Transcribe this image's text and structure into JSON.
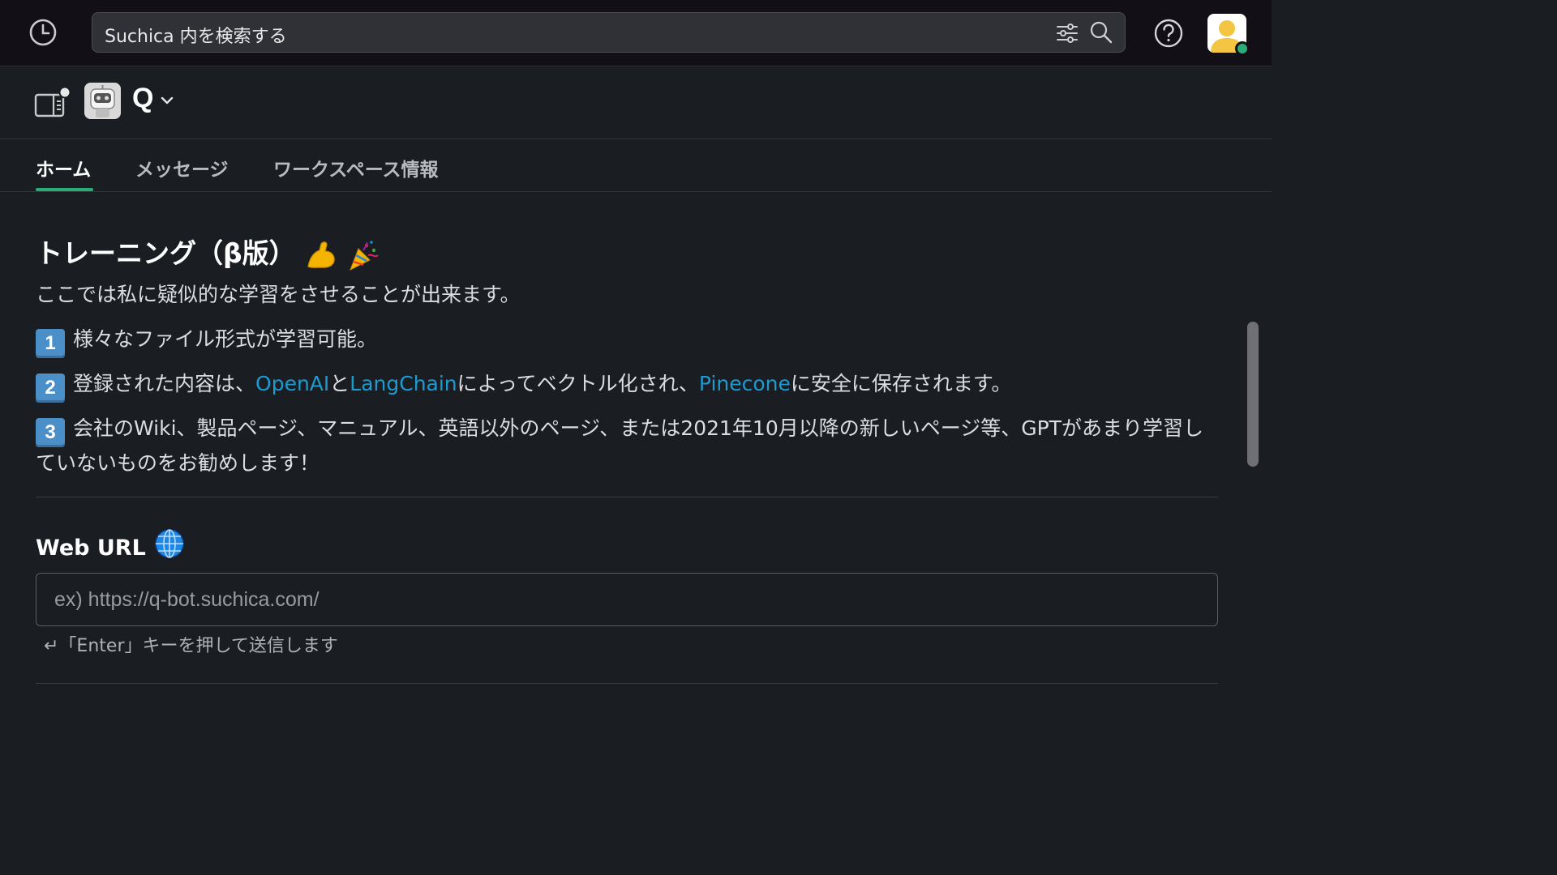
{
  "search": {
    "text": "Suchica 内を検索する"
  },
  "header": {
    "bot_name": "Q"
  },
  "tabs": [
    {
      "label": "ホーム",
      "active": true
    },
    {
      "label": "メッセージ",
      "active": false
    },
    {
      "label": "ワークスペース情報",
      "active": false
    }
  ],
  "training": {
    "title": "トレーニング（β版）",
    "intro": "ここでは私に疑似的な学習をさせることが出来ます。",
    "item1_num": "1",
    "item1_text": "様々なファイル形式が学習可能。",
    "item2_num": "2",
    "item2_pre": "登録された内容は、",
    "item2_link1": "OpenAI",
    "item2_mid1": "と",
    "item2_link2": "LangChain",
    "item2_mid2": "によってベクトル化され、",
    "item2_link3": "Pinecone",
    "item2_post": "に安全に保存されます。",
    "item3_num": "3",
    "item3_text": "会社のWiki、製品ページ、マニュアル、英語以外のページ、または2021年10月以降の新しいページ等、GPTがあまり学習していないものをお勧めします！"
  },
  "web_url": {
    "label": "Web URL",
    "placeholder": "ex) https://q-bot.suchica.com/",
    "hint": "↵「Enter」キーを押して送信します"
  },
  "colors": {
    "accent": "#2bac76",
    "link": "#1d9bd1",
    "keycap": "#4b8fc9"
  }
}
